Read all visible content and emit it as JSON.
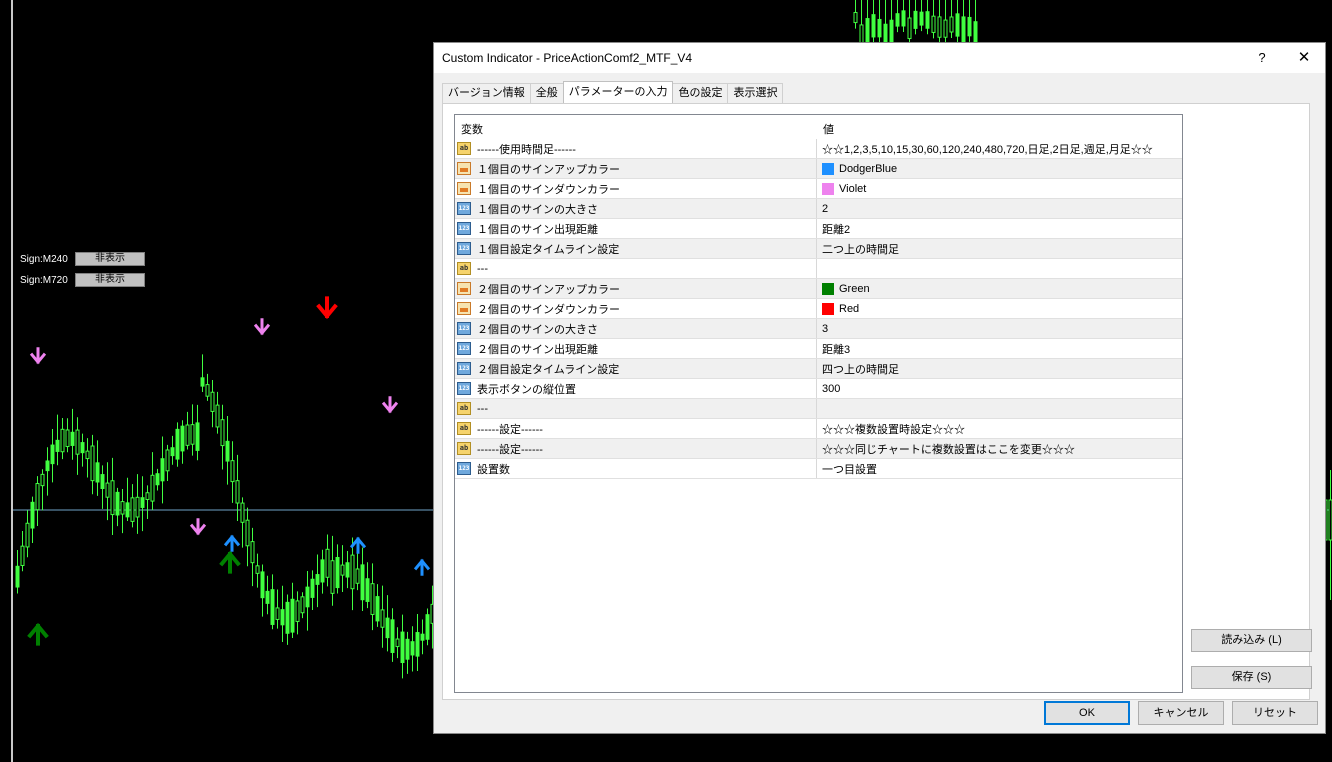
{
  "chart": {
    "sign_rows": [
      {
        "label": "Sign:M240",
        "button": "非表示"
      },
      {
        "label": "Sign:M720",
        "button": "非表示"
      }
    ],
    "colors": {
      "candle": "#40ff40",
      "dodger_blue": "#1e90ff",
      "violet": "#ee82ee",
      "green": "#008000",
      "red": "#ff0000",
      "hline": "#6fa3c7"
    }
  },
  "dialog": {
    "title": "Custom Indicator - PriceActionComf2_MTF_V4",
    "help_label": "?",
    "close_label": "✕",
    "tabs": [
      {
        "label": "バージョン情報",
        "active": false
      },
      {
        "label": "全般",
        "active": false
      },
      {
        "label": "パラメーターの入力",
        "active": true
      },
      {
        "label": "色の設定",
        "active": false
      },
      {
        "label": "表示選択",
        "active": false
      }
    ],
    "grid": {
      "col_variable": "変数",
      "col_value": "値",
      "rows": [
        {
          "type": "ab",
          "name": "------使用時間足------",
          "value": "☆☆1,2,3,5,10,15,30,60,120,240,480,720,日足,2日足,週足,月足☆☆",
          "swatch": null
        },
        {
          "type": "clr",
          "name": "１個目のサインアップカラー",
          "value": "DodgerBlue",
          "swatch": "#1e90ff"
        },
        {
          "type": "clr",
          "name": "１個目のサインダウンカラー",
          "value": "Violet",
          "swatch": "#ee82ee"
        },
        {
          "type": "num",
          "name": "１個目のサインの大きさ",
          "value": "2",
          "swatch": null
        },
        {
          "type": "num",
          "name": "１個目のサイン出現距離",
          "value": "距離2",
          "swatch": null
        },
        {
          "type": "num",
          "name": "１個目設定タイムライン設定",
          "value": "二つ上の時間足",
          "swatch": null
        },
        {
          "type": "ab",
          "name": "---",
          "value": "",
          "swatch": null
        },
        {
          "type": "clr",
          "name": "２個目のサインアップカラー",
          "value": "Green",
          "swatch": "#008000"
        },
        {
          "type": "clr",
          "name": "２個目のサインダウンカラー",
          "value": "Red",
          "swatch": "#ff0000"
        },
        {
          "type": "num",
          "name": "２個目のサインの大きさ",
          "value": "3",
          "swatch": null
        },
        {
          "type": "num",
          "name": "２個目のサイン出現距離",
          "value": "距離3",
          "swatch": null
        },
        {
          "type": "num",
          "name": "２個目設定タイムライン設定",
          "value": "四つ上の時間足",
          "swatch": null
        },
        {
          "type": "num",
          "name": "表示ボタンの縦位置",
          "value": "300",
          "swatch": null
        },
        {
          "type": "ab",
          "name": "---",
          "value": "",
          "swatch": null
        },
        {
          "type": "ab",
          "name": "------設定------",
          "value": "☆☆☆複数設置時設定☆☆☆",
          "swatch": null
        },
        {
          "type": "ab",
          "name": "------設定------",
          "value": "☆☆☆同じチャートに複数設置はここを変更☆☆☆",
          "swatch": null
        },
        {
          "type": "num",
          "name": "設置数",
          "value": "一つ目設置",
          "swatch": null
        }
      ]
    },
    "load_button": "読み込み (L)",
    "save_button": "保存 (S)",
    "ok_button": "OK",
    "cancel_button": "キャンセル",
    "reset_button": "リセット"
  }
}
